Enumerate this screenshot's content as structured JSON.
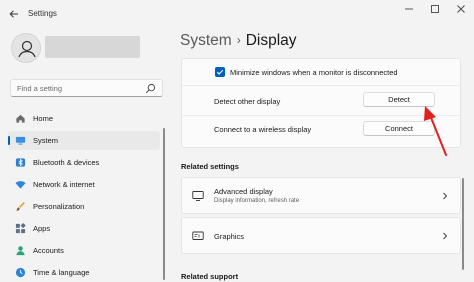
{
  "window": {
    "title": "Settings",
    "controls": [
      "minimize",
      "maximize",
      "close"
    ]
  },
  "sidebar": {
    "search_placeholder": "Find a setting",
    "items": [
      {
        "label": "Home",
        "icon": "home-icon",
        "active": false
      },
      {
        "label": "System",
        "icon": "monitor-icon",
        "active": true
      },
      {
        "label": "Bluetooth & devices",
        "icon": "bluetooth-icon",
        "active": false
      },
      {
        "label": "Network & internet",
        "icon": "wifi-icon",
        "active": false
      },
      {
        "label": "Personalization",
        "icon": "brush-icon",
        "active": false
      },
      {
        "label": "Apps",
        "icon": "apps-icon",
        "active": false
      },
      {
        "label": "Accounts",
        "icon": "person-icon",
        "active": false
      },
      {
        "label": "Time & language",
        "icon": "globe-clock-icon",
        "active": false
      }
    ]
  },
  "breadcrumb": {
    "parent": "System",
    "separator": "›",
    "current": "Display"
  },
  "multiple_displays": {
    "minimize_label": "Minimize windows when a monitor is disconnected",
    "minimize_checked": true,
    "detect_label": "Detect other display",
    "detect_button": "Detect",
    "connect_label": "Connect to a wireless display",
    "connect_button": "Connect"
  },
  "related_settings": {
    "heading": "Related settings",
    "items": [
      {
        "title": "Advanced display",
        "subtitle": "Display information, refresh rate",
        "icon": "monitor-icon"
      },
      {
        "title": "Graphics",
        "subtitle": "",
        "icon": "graphics-icon"
      }
    ]
  },
  "related_support": {
    "heading": "Related support"
  },
  "colors": {
    "accent": "#005fb8",
    "annotation_arrow": "#e02020",
    "background": "#f3f3f3",
    "card": "#fbfbfb"
  }
}
